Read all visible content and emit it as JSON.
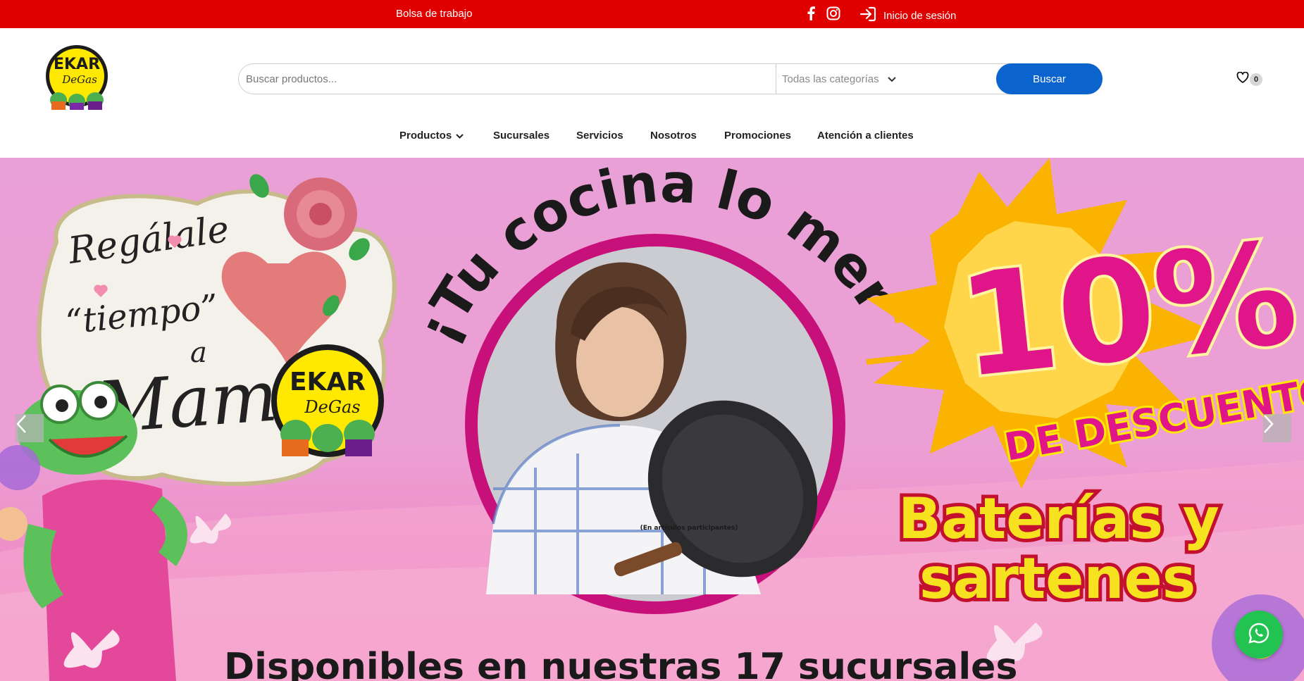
{
  "topbar": {
    "jobs_link": "Bolsa de trabajo",
    "social_icons": [
      "facebook-icon",
      "instagram-icon"
    ],
    "login_label": "Inicio de sesión",
    "login_icon": "login-icon",
    "bg_color": "#e00000"
  },
  "header": {
    "logo_text": "EKAR DeGas",
    "search": {
      "placeholder": "Buscar productos...",
      "category_select": "Todas las categorías",
      "button_label": "Buscar",
      "button_color": "#0b63ce"
    },
    "wishlist": {
      "icon": "heart-icon",
      "count": "0"
    }
  },
  "nav": {
    "items": [
      {
        "label": "Productos",
        "has_dropdown": true
      },
      {
        "label": "Sucursales"
      },
      {
        "label": "Servicios"
      },
      {
        "label": "Nosotros"
      },
      {
        "label": "Promociones"
      },
      {
        "label": "Atención a clientes"
      }
    ]
  },
  "banner": {
    "left_title_line1": "Regálale",
    "left_title_line2": "“tiempo”",
    "left_title_line3": "a",
    "left_title_line4": "Mamá",
    "arc_text": "¡Tu cocina lo merece!",
    "discount_value": "10%",
    "discount_label": "DE DESCUENTO",
    "product_line1": "Baterías y",
    "product_line2": "sartenes",
    "fine_print": "(En artículos participantes)",
    "bottom_text": "Disponibles en nuestras 17 sucursales",
    "prev_icon": "chevron-left-icon",
    "next_icon": "chevron-right-icon"
  },
  "floating": {
    "whatsapp_icon": "whatsapp-icon"
  }
}
